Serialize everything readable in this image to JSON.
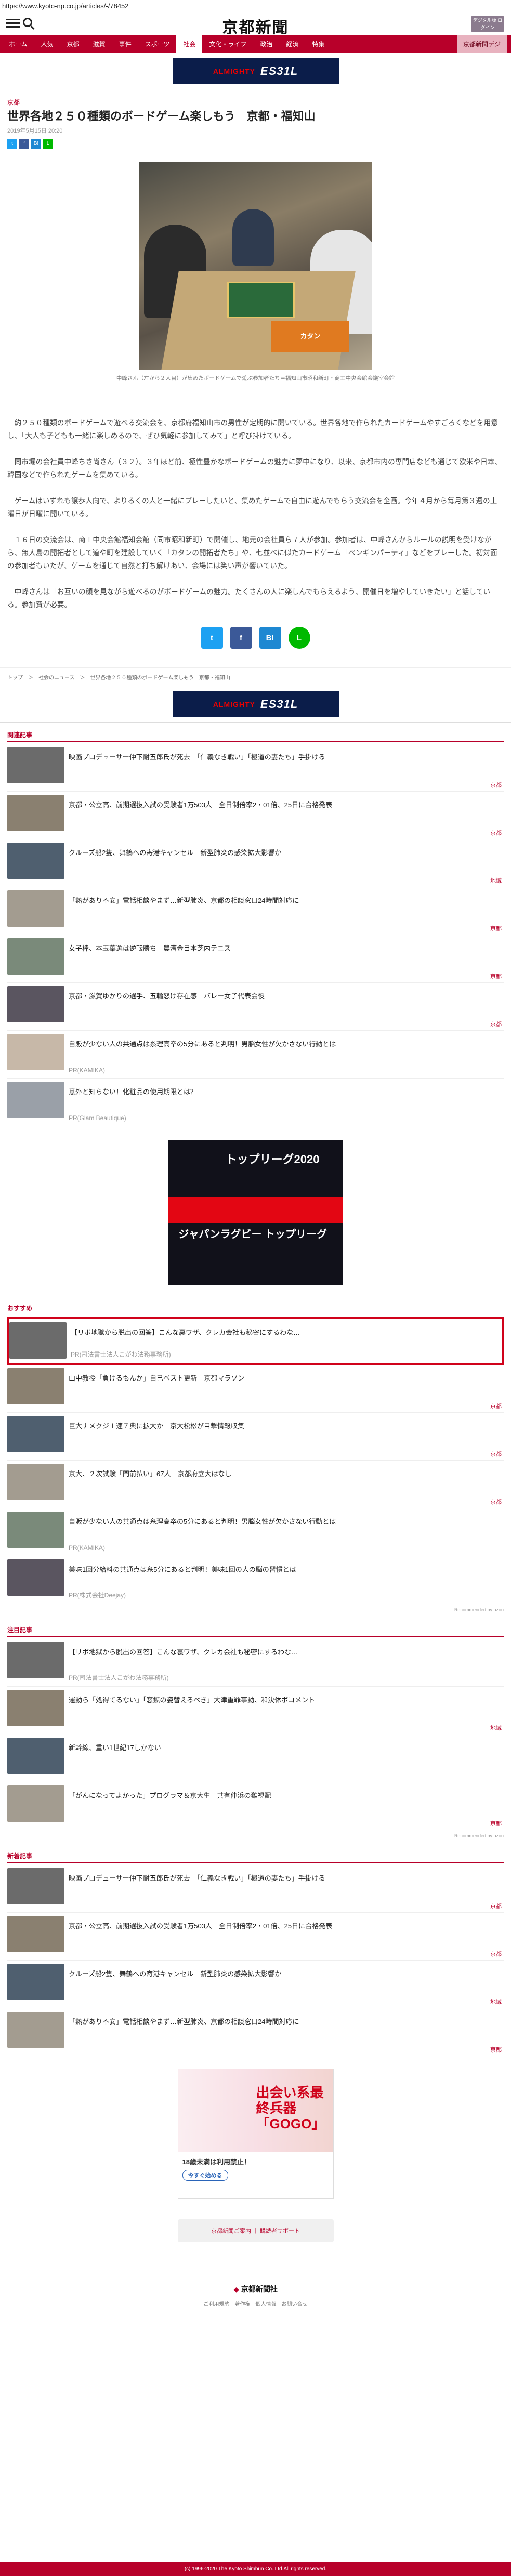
{
  "url": "https://www.kyoto-np.co.jp/articles/-/78452",
  "header": {
    "logo": "京都新聞",
    "menu_label": "メニュー 検索",
    "digital": "デジタル版 ログイン"
  },
  "nav": [
    "ホーム",
    "人気",
    "京都",
    "滋賀",
    "事件",
    "スポーツ",
    "社会",
    "文化・ライフ",
    "政治",
    "経済",
    "特集",
    "京都新聞デジ"
  ],
  "banner": {
    "brand": "ALMIGHTY",
    "text": "ES31L"
  },
  "article": {
    "category": "京都",
    "title": "世界各地２５０種類のボードゲーム楽しもう　京都・福知山",
    "date": "2019年5月15日 20:20",
    "caption": "中峰さん（左から２人目）が集めたボードゲームで遊ぶ参加者たち＝福知山市昭和新町・商工中央会館会議室会館",
    "photo_box": "カタン",
    "paragraphs": [
      "　約２５０種類のボードゲームで遊べる交流会を、京都府福知山市の男性が定期的に開いている。世界各地で作られたカードゲームやすごろくなどを用意し、「大人も子どもも一緒に楽しめるので、ぜひ気軽に参加してみて」と呼び掛けている。",
      "　同市堀の会社員中峰ちさ尚さん（３２）。３年ほど前、極性豊かなボードゲームの魅力に夢中になり、以来、京都市内の専門店なども通じて欧米や日本、韓国などで作られたゲームを集めている。",
      "　ゲームはいずれも譲歩人向で、よりるくの人と一緒にプレーしたいと、集めたゲームで自由に遊んでもらう交流会を企画。今年４月から毎月第３週の土曜日が日曜に開いている。",
      "　１６日の交流会は、商工中央会館福知会館（同市昭和新町）で開催し、地元の会社員ら７人が参加。参加者は、中峰さんからルールの説明を受けながら、無人島の開拓者として道や町を建設していく「カタンの開拓者たち」や、七並べに似たカードゲーム「ペンギンパーティ」などをプレーした。初対面の参加者もいたが、ゲームを通じて自然と打ち解けあい、会場には笑い声が響いていた。",
      "　中峰さんは「お互いの顔を見ながら遊べるのがボードゲームの魅力。たくさんの人に楽しんでもらえるよう、開催日を増やしていきたい」と話している。参加費が必要。"
    ],
    "breadcrumb": "トップ　＞　社会のニュース　＞　世界各地２５０種類のボードゲーム楽しもう　京都・福知山"
  },
  "share_small": [
    "t",
    "f",
    "B!",
    "L"
  ],
  "share_big": [
    "t",
    "f",
    "B!",
    "L"
  ],
  "related": {
    "heading": "関連記事",
    "items": [
      {
        "title": "映画プロデューサー仲下耐五郎氏が死去　「仁義なき戦い」「極道の妻たち」手掛ける",
        "tag": "京都"
      },
      {
        "title": "京都・公立高、前期選抜入試の受験者1万503人　全日制倍率2・01倍、25日に合格発表",
        "tag": "京都"
      },
      {
        "title": "クルーズ船2隻、舞鶴への寄港キャンセル　新型肺炎の感染拡大影響か",
        "tag": "地域"
      },
      {
        "title": "「熱があり不安」電話相談やまず…新型肺炎、京都の相談窓口24時間対応に",
        "tag": "京都"
      },
      {
        "title": "女子棒、本玉葉選は逆転勝ち　農漕金目本芝内テニス",
        "tag": "京都"
      },
      {
        "title": "京都・滋賀ゆかりの選手、五輪怒け存在感　バレー女子代表会役",
        "tag": "京都"
      },
      {
        "title": "自販が少ない人の共通点は糸理高卒の5分にあると判明！男脳女性が欠かさない行動とは",
        "pr": "PR(KAMIKA)"
      },
      {
        "title": "意外と知らない！化粧品の使用期限とは？",
        "pr": "PR(Glam Beautique)"
      }
    ]
  },
  "mid_ad": {
    "t1": "トップリーグ2020",
    "t2": "ジャパンラグビー トップリーグ"
  },
  "osusume": {
    "heading": "おすすめ",
    "items": [
      {
        "title": "【リボ地獄から脱出の回答】こんな裏ワザ、クレカ会社も秘密にするわな…",
        "pr": "PR(司法書士法人こがわ法務事務所)"
      },
      {
        "title": "山中教授「負けるもんか」自己ベスト更新　京都マラソン",
        "tag": "京都"
      },
      {
        "title": "巨大ナメクジ１速７典に拡大か　京大松松が目撃情報収集",
        "tag": "京都"
      },
      {
        "title": "京大、２次試験「門前払い」67人　京都府立大はなし",
        "tag": "京都"
      },
      {
        "title": "自販が少ない人の共通点は糸理高卒の5分にあると判明！男脳女性が欠かさない行動とは",
        "pr": "PR(KAMIKA)"
      },
      {
        "title": "美味1回分給料の共通点は糸5分にあると判明！美味1回の人の脳の習慣とは",
        "pr": "PR(株式会社Deejay)"
      }
    ],
    "recommended": "Recommended by uzou"
  },
  "chumoku": {
    "heading": "注目記事",
    "items": [
      {
        "title": "【リボ地獄から脱出の回答】こんな裏ワザ、クレカ会社も秘密にするわな…",
        "pr": "PR(司法書士法人こがわ法務事務所)"
      },
      {
        "title": "運動ら「処得てるない」「窓鉱の姿替えるべき」大津重罪事動、和決休ボコメント",
        "tag": "地域"
      },
      {
        "title": "新幹線、重い1世紀17しかない",
        "tag": ""
      },
      {
        "title": "「がんになってよかった」プログラマ＆京大生　共有仲浜の難視配",
        "tag": "京都"
      }
    ],
    "recommended": "Recommended by uzou"
  },
  "newest": {
    "heading": "新着記事",
    "items": [
      {
        "title": "映画プロデューサー仲下耐五郎氏が死去　「仁義なき戦い」「極道の妻たち」手掛ける",
        "tag": "京都"
      },
      {
        "title": "京都・公立高、前期選抜入試の受験者1万503人　全日制倍率2・01倍、25日に合格発表",
        "tag": "京都"
      },
      {
        "title": "クルーズ船2隻、舞鶴への寄港キャンセル　新型肺炎の感染拡大影響か",
        "tag": "地域"
      },
      {
        "title": "「熱があり不安」電話相談やまず…新型肺炎、京都の相談窓口24時間対応に",
        "tag": "京都"
      }
    ]
  },
  "square_ad": {
    "big": "出会い系最終兵器「GOGO」",
    "text": "18歳未満は利用禁止！",
    "btn": "今すぐ始める"
  },
  "footer": {
    "links": "京都新聞ご案内 ｜ 購読者サポート",
    "logo": "京都新聞社",
    "sitemap": "ご利用規約　著作権　個人情報　お問い合せ",
    "copyright": "(c) 1996-2020 The Kyoto Shimbun Co.,Ltd.All rights reserved."
  }
}
